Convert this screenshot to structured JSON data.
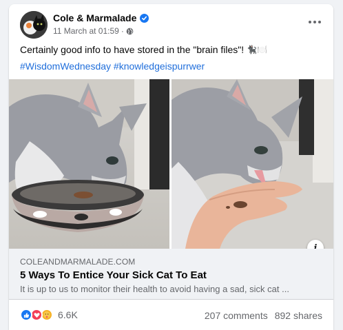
{
  "post": {
    "page_name": "Cole & Marmalade",
    "timestamp": "11 March at 01:59",
    "separator": "·",
    "text": "Certainly good info to have stored in the \"brain files\"!",
    "text_emoji": "🐈‍⬛🍽️",
    "hashtags": [
      "#WisdomWednesday",
      "#knowledgeispurrwer"
    ]
  },
  "link_preview": {
    "domain": "COLEANDMARMALADE.COM",
    "title": "5 Ways To Entice Your Sick Cat To Eat",
    "description": "It is up to us to monitor their health to avoid having a sad, sick cat ..."
  },
  "footer": {
    "reaction_count": "6.6K",
    "comments": "207 comments",
    "shares": "892 shares",
    "reaction_icons": [
      "like-icon",
      "love-icon",
      "care-icon"
    ]
  },
  "colors": {
    "link_blue": "#216fdb",
    "verified_blue": "#1877f2",
    "secondary_text": "#65676b"
  },
  "icons": {
    "info": "i"
  }
}
